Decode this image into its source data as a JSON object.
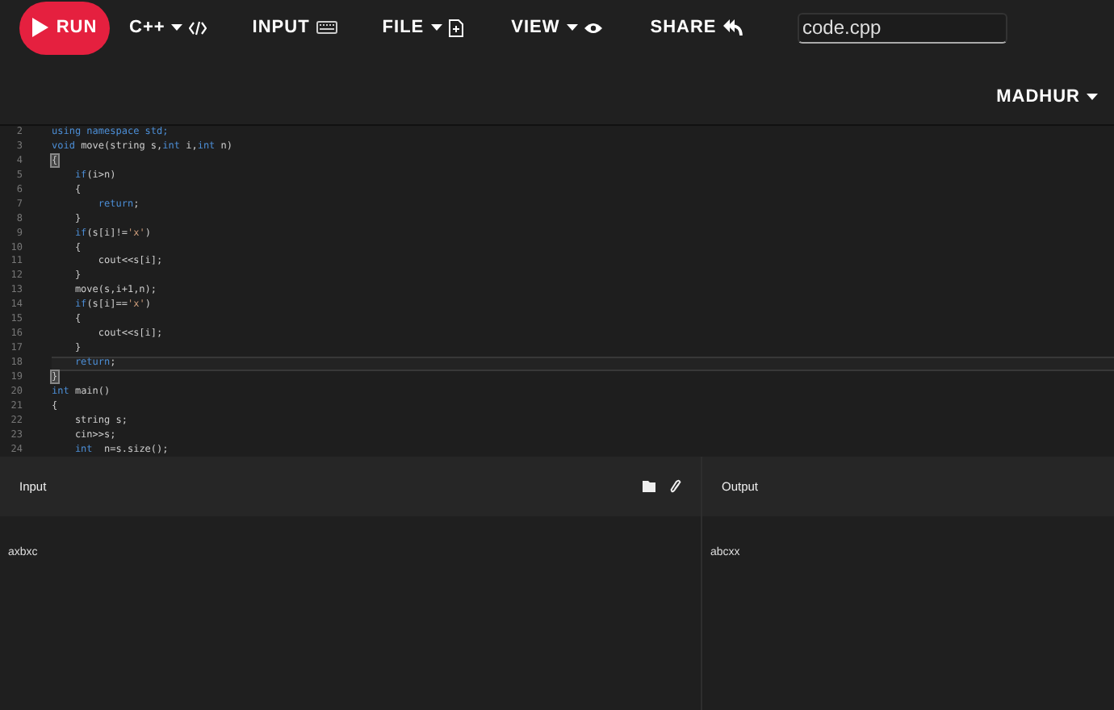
{
  "toolbar": {
    "run": {
      "label": "RUN"
    },
    "menus": [
      {
        "label": "C++",
        "kind": "dropdown"
      },
      {
        "label": "INPUT",
        "kind": "plain"
      },
      {
        "label": "FILE",
        "kind": "dropdown"
      },
      {
        "label": "VIEW",
        "kind": "dropdown"
      },
      {
        "label": "SHARE",
        "kind": "plain"
      }
    ],
    "filename": {
      "value": "code.cpp"
    },
    "user": {
      "label": "MADHUR"
    }
  },
  "editor": {
    "lines": [
      {
        "number": "2",
        "current": false,
        "tokens": [
          {
            "text": "using namespace std;",
            "kind": "keyword"
          }
        ]
      },
      {
        "number": "3",
        "current": false,
        "tokens": [
          {
            "text": "void",
            "kind": "keyword"
          },
          {
            "text": " move(string s,",
            "kind": "plain"
          },
          {
            "text": "int",
            "kind": "keyword"
          },
          {
            "text": " i,",
            "kind": "plain"
          },
          {
            "text": "int",
            "kind": "keyword"
          },
          {
            "text": " n)",
            "kind": "plain"
          }
        ]
      },
      {
        "number": "4",
        "current": false,
        "tokens": [
          {
            "text": "{",
            "kind": "bracket"
          }
        ]
      },
      {
        "number": "5",
        "current": false,
        "tokens": [
          {
            "text": "    if",
            "kind": "keyword"
          },
          {
            "text": "(i>n)",
            "kind": "plain"
          }
        ]
      },
      {
        "number": "6",
        "current": false,
        "tokens": [
          {
            "text": "    {",
            "kind": "plain"
          }
        ]
      },
      {
        "number": "7",
        "current": false,
        "tokens": [
          {
            "text": "        return",
            "kind": "keyword"
          },
          {
            "text": ";",
            "kind": "plain"
          }
        ]
      },
      {
        "number": "8",
        "current": false,
        "tokens": [
          {
            "text": "    }",
            "kind": "plain"
          }
        ]
      },
      {
        "number": "9",
        "current": false,
        "tokens": [
          {
            "text": "    if",
            "kind": "keyword"
          },
          {
            "text": "(s[i]!=",
            "kind": "plain"
          },
          {
            "text": "'x'",
            "kind": "string"
          },
          {
            "text": ")",
            "kind": "plain"
          }
        ]
      },
      {
        "number": "10",
        "current": false,
        "tokens": [
          {
            "text": "    {",
            "kind": "plain"
          }
        ]
      },
      {
        "number": "11",
        "current": false,
        "tokens": [
          {
            "text": "        cout<<s[i];",
            "kind": "plain"
          }
        ]
      },
      {
        "number": "12",
        "current": false,
        "tokens": [
          {
            "text": "    }",
            "kind": "plain"
          }
        ]
      },
      {
        "number": "13",
        "current": false,
        "tokens": [
          {
            "text": "    move(s,i+1,n);",
            "kind": "plain"
          }
        ]
      },
      {
        "number": "14",
        "current": false,
        "tokens": [
          {
            "text": "    if",
            "kind": "keyword"
          },
          {
            "text": "(s[i]==",
            "kind": "plain"
          },
          {
            "text": "'x'",
            "kind": "string"
          },
          {
            "text": ")",
            "kind": "plain"
          }
        ]
      },
      {
        "number": "15",
        "current": false,
        "tokens": [
          {
            "text": "    {",
            "kind": "plain"
          }
        ]
      },
      {
        "number": "16",
        "current": false,
        "tokens": [
          {
            "text": "        cout<<s[i];",
            "kind": "plain"
          }
        ]
      },
      {
        "number": "17",
        "current": false,
        "tokens": [
          {
            "text": "    }",
            "kind": "plain"
          }
        ]
      },
      {
        "number": "18",
        "current": true,
        "tokens": [
          {
            "text": "    return",
            "kind": "keyword"
          },
          {
            "text": ";",
            "kind": "plain"
          }
        ]
      },
      {
        "number": "19",
        "current": false,
        "tokens": [
          {
            "text": "}",
            "kind": "bracket"
          }
        ]
      },
      {
        "number": "20",
        "current": false,
        "tokens": [
          {
            "text": "int",
            "kind": "keyword"
          },
          {
            "text": " main()",
            "kind": "plain"
          }
        ]
      },
      {
        "number": "21",
        "current": false,
        "tokens": [
          {
            "text": "{",
            "kind": "plain"
          }
        ]
      },
      {
        "number": "22",
        "current": false,
        "tokens": [
          {
            "text": "    string s;",
            "kind": "plain"
          }
        ]
      },
      {
        "number": "23",
        "current": false,
        "tokens": [
          {
            "text": "    cin>>s;",
            "kind": "plain"
          }
        ]
      },
      {
        "number": "24",
        "current": false,
        "tokens": [
          {
            "text": "    int",
            "kind": "keyword"
          },
          {
            "text": "  n=s.size();",
            "kind": "plain"
          }
        ]
      }
    ]
  },
  "input_panel": {
    "title": "Input",
    "value": "axbxc"
  },
  "output_panel": {
    "title": "Output",
    "value": "abcxx"
  }
}
